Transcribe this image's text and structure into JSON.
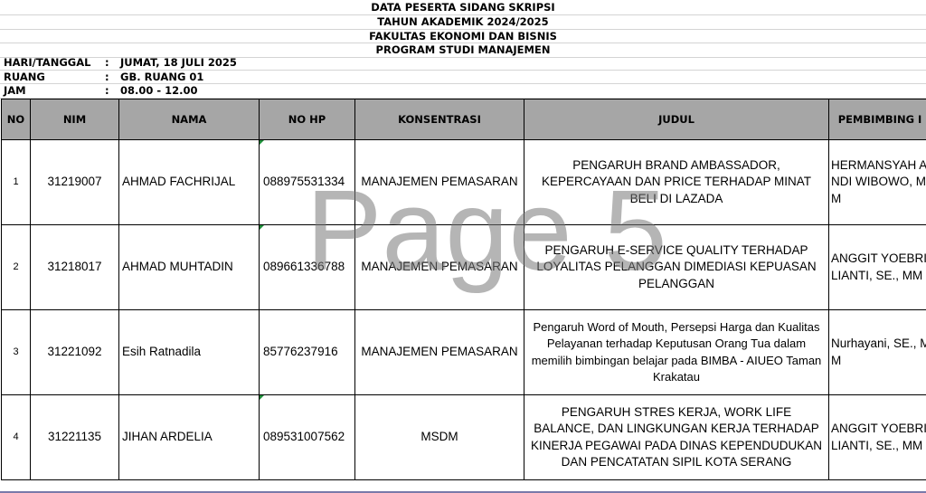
{
  "title_lines": [
    "DATA PESERTA SIDANG SKRIPSI",
    "TAHUN AKADEMIK 2024/2025",
    "FAKULTAS EKONOMI DAN BISNIS",
    "PROGRAM STUDI MANAJEMEN"
  ],
  "info": [
    {
      "label": "HARI/TANGGAL",
      "colon": ":",
      "value": "JUMAT, 18 JULI 2025"
    },
    {
      "label": "RUANG",
      "colon": ":",
      "value": "GB. RUANG 01"
    },
    {
      "label": "JAM",
      "colon": ":",
      "value": "08.00 - 12.00"
    }
  ],
  "headers": {
    "no": "NO",
    "nim": "NIM",
    "nama": "NAMA",
    "hp": "NO HP",
    "konsentrasi": "KONSENTRASI",
    "judul": "JUDUL",
    "pembimbing": "PEMBIMBING I"
  },
  "rows": [
    {
      "no": "1",
      "nim": "31219007",
      "nama": "AHMAD FACHRIJAL",
      "hp": "088975531334",
      "konsentrasi": "MANAJEMEN PEMASARAN",
      "judul": "PENGARUH BRAND AMBASSADOR, KEPERCAYAAN DAN PRICE TERHADAP MINAT BELI DI LAZADA",
      "pembimbing": "HERMANSYAH ANDI WIBOWO, MM"
    },
    {
      "no": "2",
      "nim": "31218017",
      "nama": "AHMAD MUHTADIN",
      "hp": "089661336788",
      "konsentrasi": "MANAJEMEN PEMASARAN",
      "judul": "PENGARUH E-SERVICE QUALITY TERHADAP LOYALITAS PELANGGAN DIMEDIASI KEPUASAN PELANGGAN",
      "pembimbing": "ANGGIT YOEBRILIANTI, SE., MM"
    },
    {
      "no": "3",
      "nim": "31221092",
      "nama": "Esih Ratnadila",
      "hp": "85776237916",
      "konsentrasi": "MANAJEMEN PEMASARAN",
      "judul": "Pengaruh Word of Mouth, Persepsi Harga dan Kualitas Pelayanan terhadap Keputusan Orang Tua dalam memilih bimbingan belajar pada BIMBA - AIUEO Taman Krakatau",
      "pembimbing": "Nurhayani, SE., MM"
    },
    {
      "no": "4",
      "nim": "31221135",
      "nama": "JIHAN ARDELIA",
      "hp": "089531007562",
      "konsentrasi": "MSDM",
      "judul": "PENGARUH STRES KERJA, WORK LIFE BALANCE, DAN LINGKUNGAN KERJA TERHADAP KINERJA PEGAWAI PADA DINAS KEPENDUDUKAN DAN PENCATATAN SIPIL KOTA SERANG",
      "pembimbing": "ANGGIT YOEBRILIANTI, SE., MM"
    }
  ],
  "watermark": "Page 5",
  "colors": {
    "header_bg": "#a6a6a6",
    "marker": "#1e8f3a"
  }
}
